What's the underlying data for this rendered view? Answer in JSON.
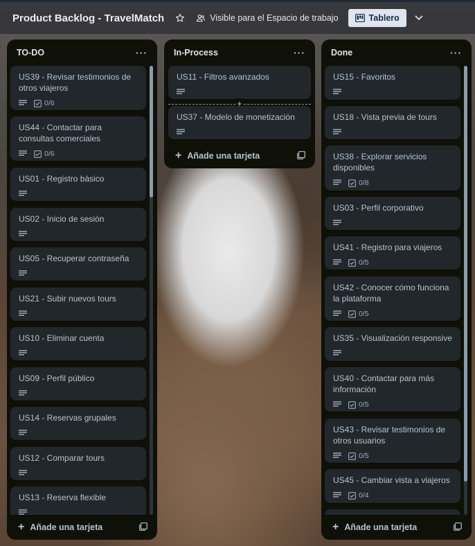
{
  "header": {
    "board_title": "Product Backlog - TravelMatch",
    "visibility_label": "Visible para el Espacio de trabajo",
    "view_label": "Tablero",
    "star_icon": "star-icon",
    "visibility_icon": "people-icon",
    "view_icon": "board-icon"
  },
  "lists": [
    {
      "title": "TO-DO",
      "menu": "···",
      "add_card_label": "Añade una tarjeta",
      "cards": [
        {
          "title": "US39 - Revisar testimonios de otros viajeros",
          "checklist": "0/6"
        },
        {
          "title": "US44 - Contactar para consultas comerciales",
          "checklist": "0/6"
        },
        {
          "title": "US01 - Registro básico"
        },
        {
          "title": "US02 - Inicio de sesión"
        },
        {
          "title": "US05 - Recuperar contraseña"
        },
        {
          "title": "US21 - Subir nuevos tours"
        },
        {
          "title": "US10 - Eliminar cuenta"
        },
        {
          "title": "US09 - Perfil público"
        },
        {
          "title": "US14 - Reservas grupales"
        },
        {
          "title": "US12 - Comparar tours"
        },
        {
          "title": "US13 - Reserva flexible"
        }
      ]
    },
    {
      "title": "In-Process",
      "menu": "···",
      "add_card_label": "Añade una tarjeta",
      "cards": [
        {
          "title": "US11 - Filtros avanzados"
        },
        {
          "title": "US37 - Modelo de monetización"
        }
      ]
    },
    {
      "title": "Done",
      "menu": "···",
      "add_card_label": "Añade una tarjeta",
      "cards": [
        {
          "title": "US15 - Favoritos"
        },
        {
          "title": "US18 - Vista previa de tours"
        },
        {
          "title": "US38 - Explorar servicios disponibles",
          "checklist": "0/8"
        },
        {
          "title": "US03 - Perfil corporativo"
        },
        {
          "title": "US41 - Registro para viajeros",
          "checklist": "0/5"
        },
        {
          "title": "US42 - Conocer cómo funciona la plataforma",
          "checklist": "0/5"
        },
        {
          "title": "US35 - Visualización responsive"
        },
        {
          "title": "US40 - Contactar para más información",
          "checklist": "0/5"
        },
        {
          "title": "US43 - Revisar testimonios de otros usuarios",
          "checklist": "0/5"
        },
        {
          "title": "US45 - Cambiar vista a viajeros",
          "checklist": "0/4"
        }
      ]
    }
  ],
  "colors": {
    "list_bg": "#0f1108",
    "card_bg": "#22272b",
    "card_text": "#b6c2cf",
    "header_text": "#e9edf2"
  }
}
